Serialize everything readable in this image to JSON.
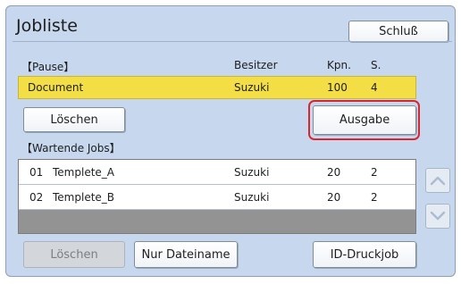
{
  "header": {
    "title": "Jobliste",
    "close_label": "Schluß"
  },
  "paused": {
    "section_label": "【Pause】",
    "columns": {
      "owner": "Besitzer",
      "copies": "Kpn.",
      "sets": "S."
    },
    "job": {
      "name": "Document",
      "owner": "Suzuki",
      "copies": "100",
      "sets": "4"
    },
    "delete_label": "Löschen",
    "output_label": "Ausgabe"
  },
  "waiting": {
    "section_label": "【Wartende Jobs】",
    "jobs": [
      {
        "num": "01",
        "name": "Templete_A",
        "owner": "Suzuki",
        "copies": "20",
        "sets": "2"
      },
      {
        "num": "02",
        "name": "Templete_B",
        "owner": "Suzuki",
        "copies": "20",
        "sets": "2"
      }
    ]
  },
  "footer": {
    "delete_label": "Löschen",
    "filename_only_label": "Nur Dateiname",
    "id_print_label": "ID-Druckjob"
  },
  "colors": {
    "panel": "#c6d7ee",
    "selected_row": "#f3df45",
    "highlight": "#d9262d"
  },
  "icons": {
    "scroll_up": "chevron-up-icon",
    "scroll_down": "chevron-down-icon"
  }
}
